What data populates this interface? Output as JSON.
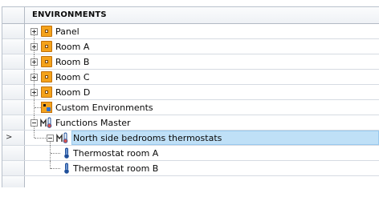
{
  "header": {
    "title": "ENVIRONMENTS"
  },
  "rows": [
    {
      "label": "Panel"
    },
    {
      "label": "Room A"
    },
    {
      "label": "Room B"
    },
    {
      "label": "Room C"
    },
    {
      "label": "Room D"
    },
    {
      "label": "Custom Environments"
    },
    {
      "label": "Functions Master"
    },
    {
      "label": "North side bedrooms thermostats"
    },
    {
      "label": "Thermostat room A"
    },
    {
      "label": "Thermostat room B"
    }
  ],
  "selected_row_marker": ">",
  "colors": {
    "selection": "#bfe0f7",
    "environment_icon": "#f4a21b",
    "thermostat_icon": "#1f4f9a"
  }
}
